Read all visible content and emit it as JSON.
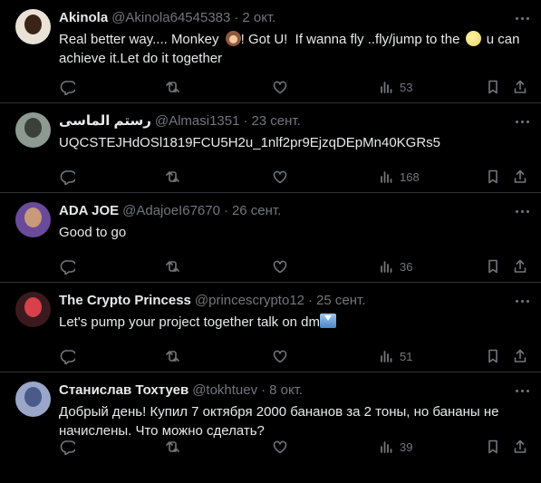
{
  "tweets": [
    {
      "name": "Akinola",
      "handle": "@Akinola64545383",
      "date": "2 окт.",
      "text_parts": [
        "Real better way.... Monkey ",
        "! Got U!  If wanna fly ..fly/jump to the ",
        " u can achieve it.Let do it together"
      ],
      "views": "53",
      "avatar_colors": [
        "#e9e2d6",
        "#3a2418"
      ]
    },
    {
      "name": "رستم الماسی",
      "handle": "@Almasi1351",
      "date": "23 сент.",
      "text": "UQCSTEJHdOSl1819FCU5H2u_1nlf2pr9EjzqDEpMn40KGRs5",
      "views": "168",
      "avatar_colors": [
        "#8c9a92",
        "#3d3f3a"
      ]
    },
    {
      "name": "ADA JOE",
      "handle": "@AdajoeI67670",
      "date": "26 сент.",
      "text": "Good to go",
      "views": "36",
      "avatar_colors": [
        "#6a4a9a",
        "#c89a7a"
      ]
    },
    {
      "name": "The Crypto Princess",
      "handle": "@princescrypto12",
      "date": "25 сент.",
      "text": "Let's pump your project together talk on dm",
      "views": "51",
      "avatar_colors": [
        "#3a1a1e",
        "#d8404a"
      ]
    },
    {
      "name": "Станислав Тохтуев",
      "handle": "@tokhtuev",
      "date": "8 окт.",
      "text": "Добрый день! Купил 7 октября 2000 бананов за 2 тоны, но бананы не начислены. Что можно сделать?",
      "views": "39",
      "avatar_colors": [
        "#9aa7c8",
        "#4a5a8a"
      ]
    }
  ],
  "colors": {
    "background": "#000000",
    "text": "#e7e9ea",
    "muted": "#71767b",
    "divider": "#2f3336"
  },
  "icons": [
    "reply-icon",
    "retweet-icon",
    "like-icon",
    "views-icon",
    "bookmark-icon",
    "share-icon",
    "more-icon"
  ]
}
